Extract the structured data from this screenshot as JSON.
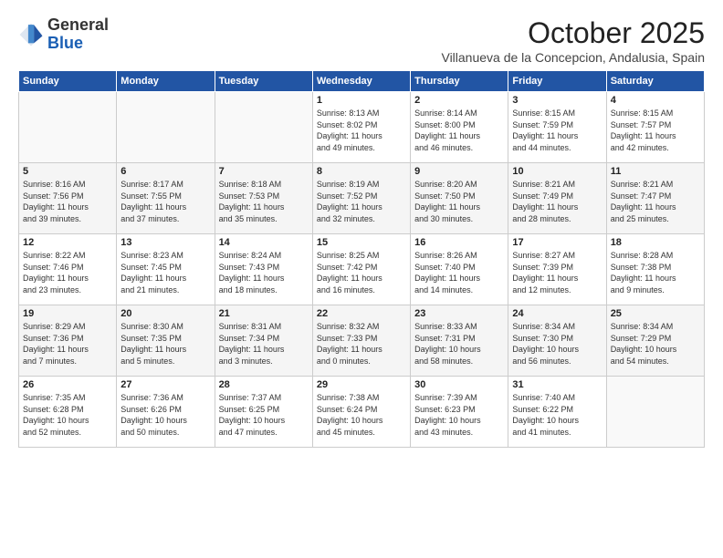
{
  "logo": {
    "general": "General",
    "blue": "Blue"
  },
  "title": "October 2025",
  "subtitle": "Villanueva de la Concepcion, Andalusia, Spain",
  "days_header": [
    "Sunday",
    "Monday",
    "Tuesday",
    "Wednesday",
    "Thursday",
    "Friday",
    "Saturday"
  ],
  "weeks": [
    [
      {
        "day": "",
        "info": ""
      },
      {
        "day": "",
        "info": ""
      },
      {
        "day": "",
        "info": ""
      },
      {
        "day": "1",
        "info": "Sunrise: 8:13 AM\nSunset: 8:02 PM\nDaylight: 11 hours\nand 49 minutes."
      },
      {
        "day": "2",
        "info": "Sunrise: 8:14 AM\nSunset: 8:00 PM\nDaylight: 11 hours\nand 46 minutes."
      },
      {
        "day": "3",
        "info": "Sunrise: 8:15 AM\nSunset: 7:59 PM\nDaylight: 11 hours\nand 44 minutes."
      },
      {
        "day": "4",
        "info": "Sunrise: 8:15 AM\nSunset: 7:57 PM\nDaylight: 11 hours\nand 42 minutes."
      }
    ],
    [
      {
        "day": "5",
        "info": "Sunrise: 8:16 AM\nSunset: 7:56 PM\nDaylight: 11 hours\nand 39 minutes."
      },
      {
        "day": "6",
        "info": "Sunrise: 8:17 AM\nSunset: 7:55 PM\nDaylight: 11 hours\nand 37 minutes."
      },
      {
        "day": "7",
        "info": "Sunrise: 8:18 AM\nSunset: 7:53 PM\nDaylight: 11 hours\nand 35 minutes."
      },
      {
        "day": "8",
        "info": "Sunrise: 8:19 AM\nSunset: 7:52 PM\nDaylight: 11 hours\nand 32 minutes."
      },
      {
        "day": "9",
        "info": "Sunrise: 8:20 AM\nSunset: 7:50 PM\nDaylight: 11 hours\nand 30 minutes."
      },
      {
        "day": "10",
        "info": "Sunrise: 8:21 AM\nSunset: 7:49 PM\nDaylight: 11 hours\nand 28 minutes."
      },
      {
        "day": "11",
        "info": "Sunrise: 8:21 AM\nSunset: 7:47 PM\nDaylight: 11 hours\nand 25 minutes."
      }
    ],
    [
      {
        "day": "12",
        "info": "Sunrise: 8:22 AM\nSunset: 7:46 PM\nDaylight: 11 hours\nand 23 minutes."
      },
      {
        "day": "13",
        "info": "Sunrise: 8:23 AM\nSunset: 7:45 PM\nDaylight: 11 hours\nand 21 minutes."
      },
      {
        "day": "14",
        "info": "Sunrise: 8:24 AM\nSunset: 7:43 PM\nDaylight: 11 hours\nand 18 minutes."
      },
      {
        "day": "15",
        "info": "Sunrise: 8:25 AM\nSunset: 7:42 PM\nDaylight: 11 hours\nand 16 minutes."
      },
      {
        "day": "16",
        "info": "Sunrise: 8:26 AM\nSunset: 7:40 PM\nDaylight: 11 hours\nand 14 minutes."
      },
      {
        "day": "17",
        "info": "Sunrise: 8:27 AM\nSunset: 7:39 PM\nDaylight: 11 hours\nand 12 minutes."
      },
      {
        "day": "18",
        "info": "Sunrise: 8:28 AM\nSunset: 7:38 PM\nDaylight: 11 hours\nand 9 minutes."
      }
    ],
    [
      {
        "day": "19",
        "info": "Sunrise: 8:29 AM\nSunset: 7:36 PM\nDaylight: 11 hours\nand 7 minutes."
      },
      {
        "day": "20",
        "info": "Sunrise: 8:30 AM\nSunset: 7:35 PM\nDaylight: 11 hours\nand 5 minutes."
      },
      {
        "day": "21",
        "info": "Sunrise: 8:31 AM\nSunset: 7:34 PM\nDaylight: 11 hours\nand 3 minutes."
      },
      {
        "day": "22",
        "info": "Sunrise: 8:32 AM\nSunset: 7:33 PM\nDaylight: 11 hours\nand 0 minutes."
      },
      {
        "day": "23",
        "info": "Sunrise: 8:33 AM\nSunset: 7:31 PM\nDaylight: 10 hours\nand 58 minutes."
      },
      {
        "day": "24",
        "info": "Sunrise: 8:34 AM\nSunset: 7:30 PM\nDaylight: 10 hours\nand 56 minutes."
      },
      {
        "day": "25",
        "info": "Sunrise: 8:34 AM\nSunset: 7:29 PM\nDaylight: 10 hours\nand 54 minutes."
      }
    ],
    [
      {
        "day": "26",
        "info": "Sunrise: 7:35 AM\nSunset: 6:28 PM\nDaylight: 10 hours\nand 52 minutes."
      },
      {
        "day": "27",
        "info": "Sunrise: 7:36 AM\nSunset: 6:26 PM\nDaylight: 10 hours\nand 50 minutes."
      },
      {
        "day": "28",
        "info": "Sunrise: 7:37 AM\nSunset: 6:25 PM\nDaylight: 10 hours\nand 47 minutes."
      },
      {
        "day": "29",
        "info": "Sunrise: 7:38 AM\nSunset: 6:24 PM\nDaylight: 10 hours\nand 45 minutes."
      },
      {
        "day": "30",
        "info": "Sunrise: 7:39 AM\nSunset: 6:23 PM\nDaylight: 10 hours\nand 43 minutes."
      },
      {
        "day": "31",
        "info": "Sunrise: 7:40 AM\nSunset: 6:22 PM\nDaylight: 10 hours\nand 41 minutes."
      },
      {
        "day": "",
        "info": ""
      }
    ]
  ]
}
